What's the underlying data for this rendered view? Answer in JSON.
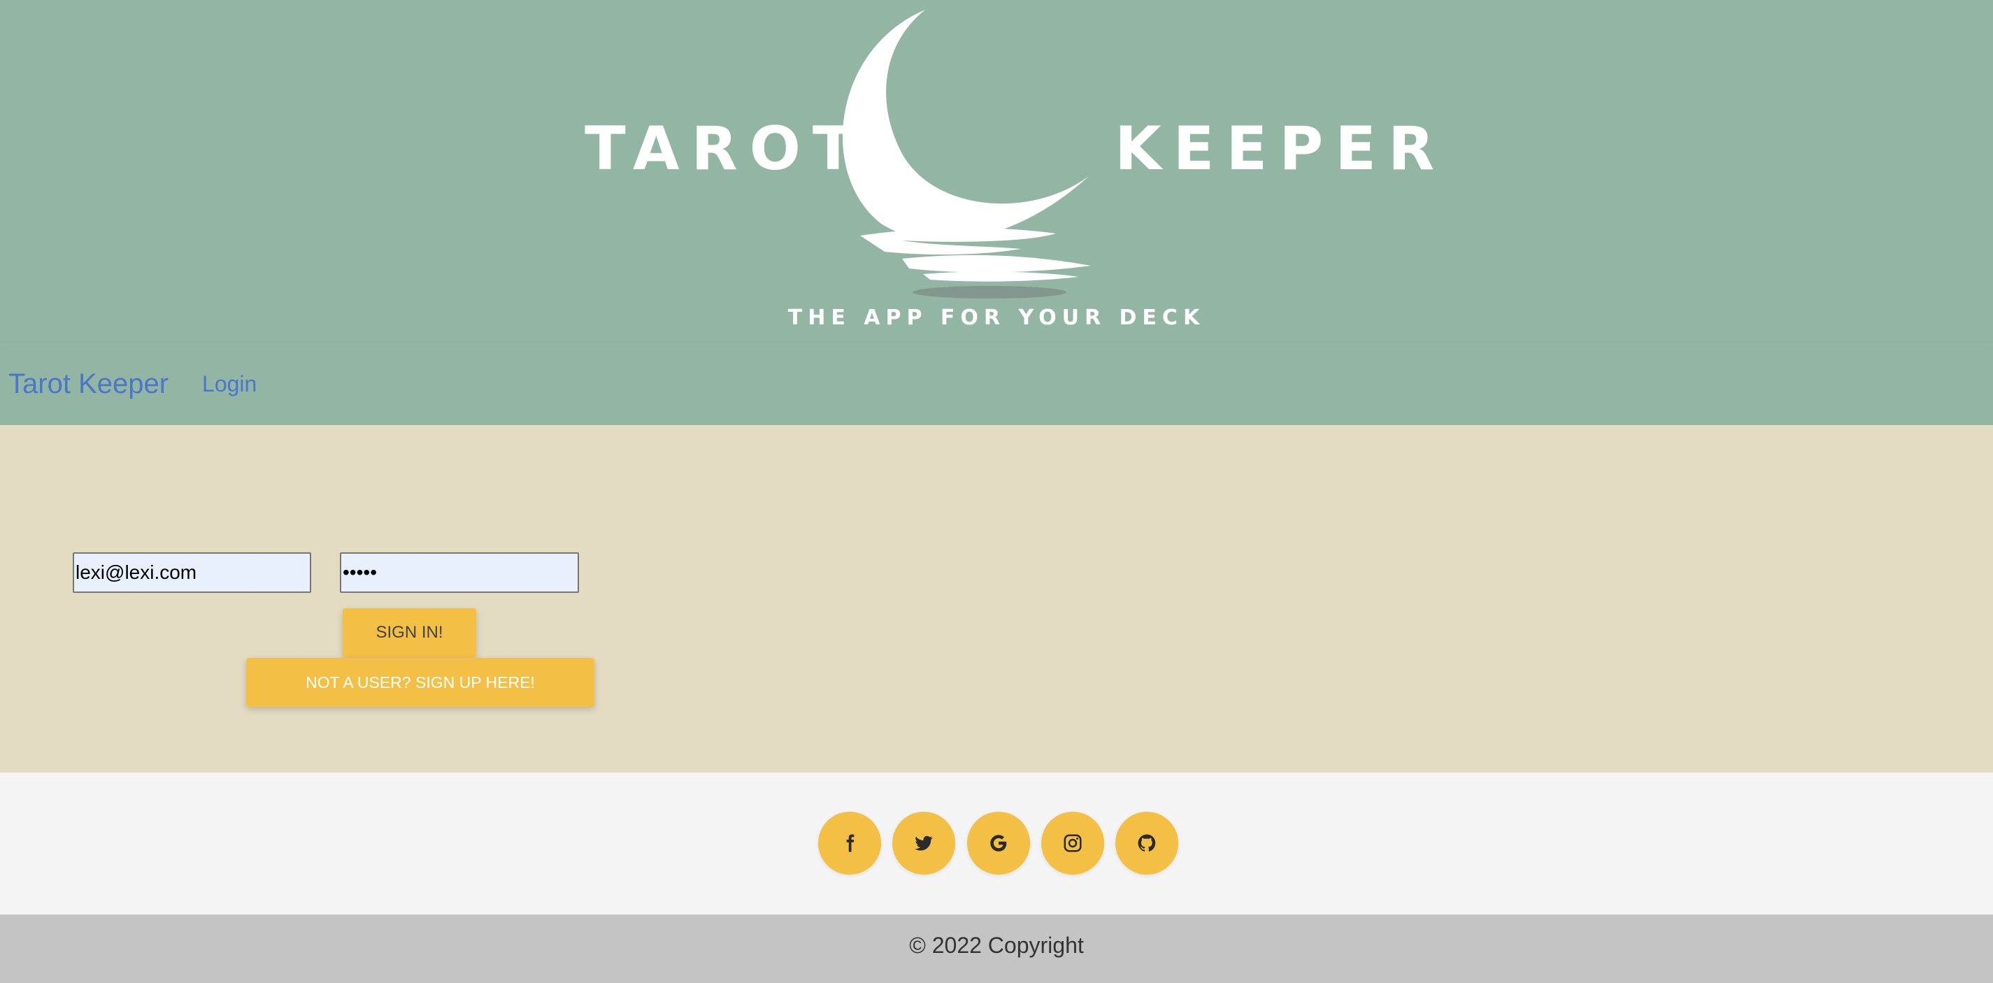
{
  "banner": {
    "logo_word_left": "TAROT",
    "logo_word_right": "KEEPER",
    "tagline": "THE APP FOR YOUR DECK"
  },
  "navbar": {
    "brand": "Tarot Keeper",
    "links": [
      "Login"
    ]
  },
  "login_form": {
    "email_value": "lexi@lexi.com",
    "password_value": "•••••",
    "sign_in_label": "SIGN IN!",
    "sign_up_label": "NOT A USER? SIGN UP HERE!"
  },
  "social": {
    "icons": [
      "facebook-icon",
      "twitter-icon",
      "google-icon",
      "instagram-icon",
      "github-icon"
    ]
  },
  "footer": {
    "copyright": "© 2022 Copyright"
  },
  "colors": {
    "header_bg": "#93b5a4",
    "page_bg": "#e3dcc3",
    "accent": "#f4bf45",
    "link": "#4b77c9",
    "social_bg": "#f4f4f4",
    "footer_bg": "#c4c4c4"
  }
}
